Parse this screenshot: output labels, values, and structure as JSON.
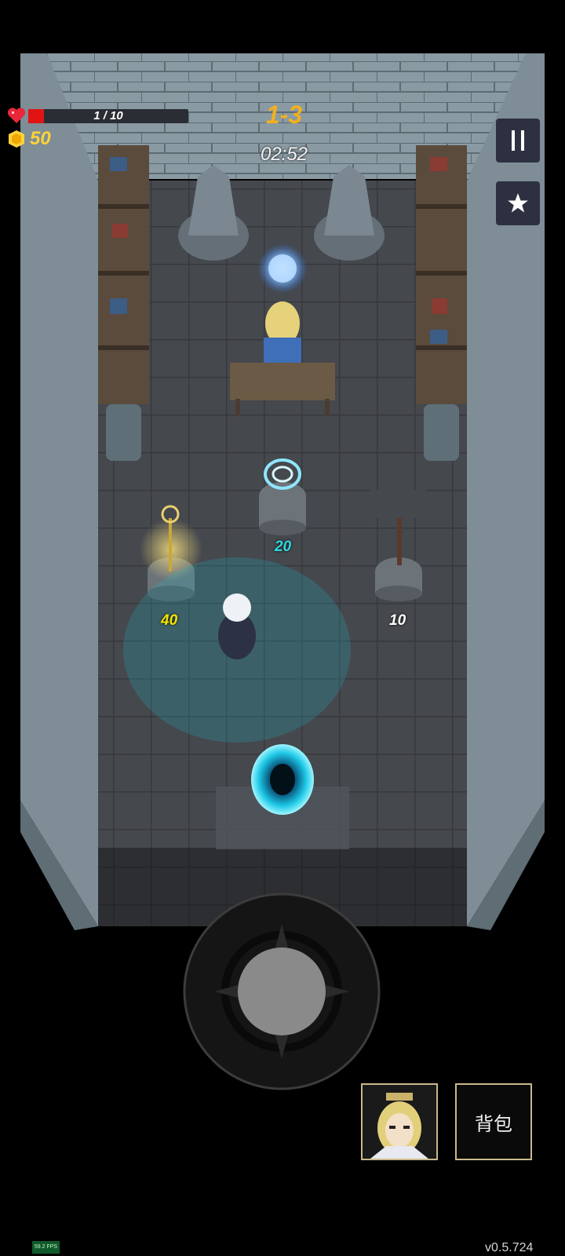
{
  "hud": {
    "health_text": "1 / 10",
    "health_fraction": 0.1,
    "coins": "50",
    "level": "1-3",
    "timer": "02:52"
  },
  "side_buttons": {
    "pause_icon": "pause-icon",
    "favorite_icon": "star-icon"
  },
  "shop_items": [
    {
      "item": "staff",
      "price": "40",
      "color": "#f5e400"
    },
    {
      "item": "magic-orb",
      "price": "20",
      "color": "#2fd8e0"
    },
    {
      "item": "hammer",
      "price": "10",
      "color": "#ffffff"
    }
  ],
  "bottom": {
    "bag_label": "背包",
    "fps": "59.2 FPS",
    "version": "v0.5.724"
  },
  "colors": {
    "health": "#e01414",
    "gold": "#ffd23a",
    "level": "#f0b020",
    "portal": "#1ec8e6",
    "slot_border": "#c9b88a"
  }
}
